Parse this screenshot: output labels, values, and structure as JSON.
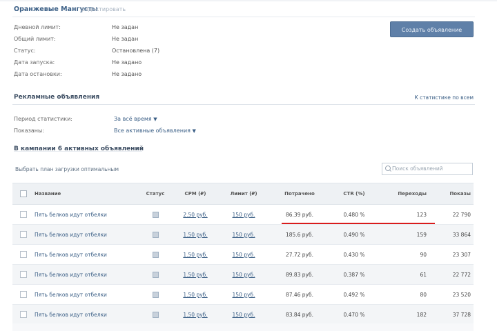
{
  "campaign": {
    "title": "Оранжевые Мангусты",
    "edit_label": "редактировать",
    "info": [
      {
        "label": "Дневной лимит:",
        "value": "Не задан"
      },
      {
        "label": "Общий лимит:",
        "value": "Не задан"
      },
      {
        "label": "Статус:",
        "value": "Остановлена (7)"
      },
      {
        "label": "Дата запуска:",
        "value": "Не задано"
      },
      {
        "label": "Дата остановки:",
        "value": "Не задано"
      }
    ],
    "create_button": "Создать объявление"
  },
  "ads_section": {
    "title": "Рекламные объявления",
    "stats_link": "К статистике по всем"
  },
  "filters": [
    {
      "label": "Период статистики:",
      "value": "За всё время"
    },
    {
      "label": "Показаны:",
      "value": "Все активные объявления"
    }
  ],
  "list_header": "В кампании 6 активных объявлений",
  "hint": "Выбрать план загрузки оптимальным",
  "search": {
    "placeholder": "Поиск объявлений"
  },
  "table": {
    "columns": [
      "Название",
      "Статус",
      "CPM (₽)",
      "Лимит (₽)",
      "Потрачено",
      "CTR (%)",
      "Переходы",
      "Показы"
    ],
    "rows": [
      {
        "name": "Пять белков идут отбелки",
        "cpm": "2.50 руб.",
        "limit": "150 руб.",
        "spent": "86.39 руб.",
        "ctr": "0.480 %",
        "clicks": "123",
        "shows": "22 790"
      },
      {
        "name": "Пять белков идут отбелки",
        "cpm": "1.50 руб.",
        "limit": "150 руб.",
        "spent": "185.6 руб.",
        "ctr": "0.490 %",
        "clicks": "159",
        "shows": "33 864"
      },
      {
        "name": "Пять белков идут отбелки",
        "cpm": "1.50 руб.",
        "limit": "150 руб.",
        "spent": "27.72 руб.",
        "ctr": "0.430 %",
        "clicks": "90",
        "shows": "23 307"
      },
      {
        "name": "Пять белков идут отбелки",
        "cpm": "1.50 руб.",
        "limit": "150 руб.",
        "spent": "89.83 руб.",
        "ctr": "0.387 %",
        "clicks": "61",
        "shows": "22 772"
      },
      {
        "name": "Пять белков идут отбелки",
        "cpm": "1.50 руб.",
        "limit": "150 руб.",
        "spent": "87.46 руб.",
        "ctr": "0.492 %",
        "clicks": "80",
        "shows": "23 520"
      },
      {
        "name": "Пять белков идут отбелки",
        "cpm": "1.50 руб.",
        "limit": "150 руб.",
        "spent": "83.84 руб.",
        "ctr": "0.470 %",
        "clicks": "182",
        "shows": "37 728"
      }
    ]
  },
  "colors": {
    "accent": "#3b5f86",
    "button": "#5f80a8",
    "highlight": "#d91c1c"
  }
}
